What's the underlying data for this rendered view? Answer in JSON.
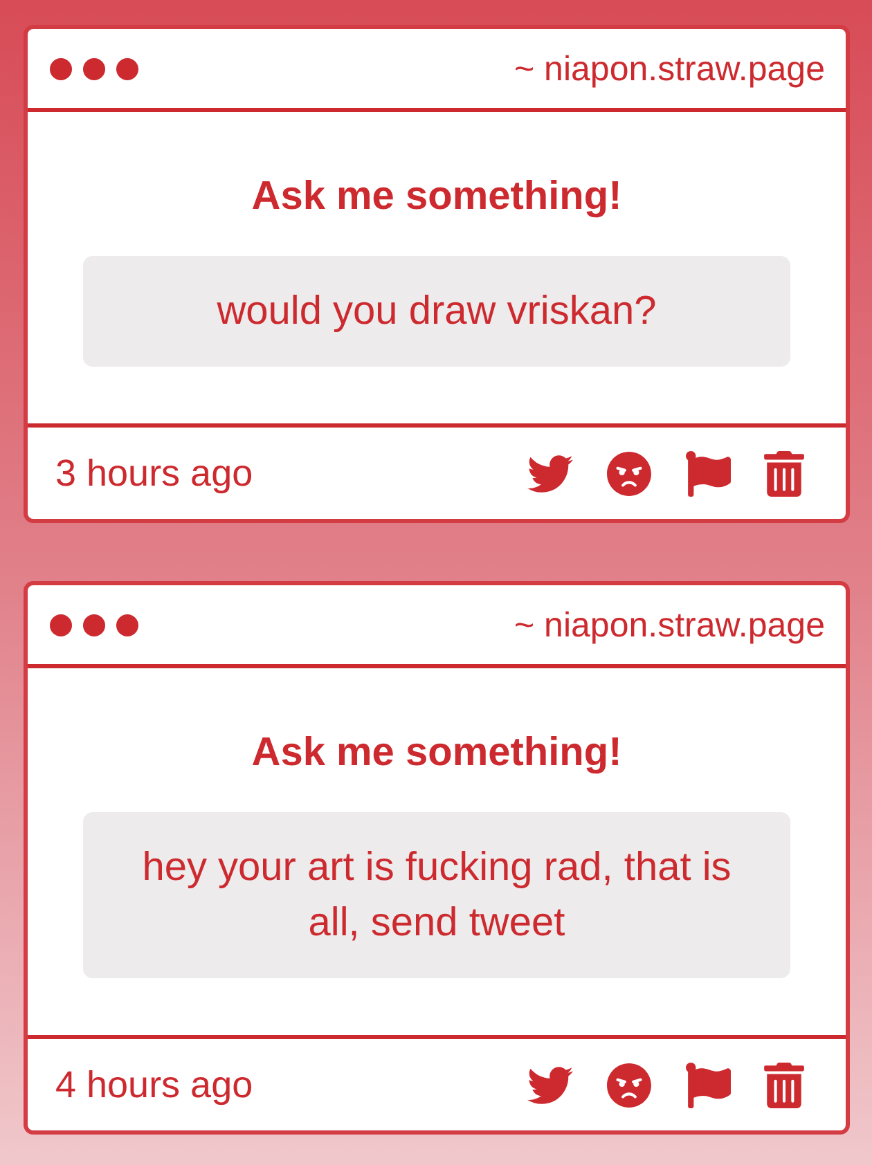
{
  "cards": [
    {
      "header": {
        "url": "~ niapon.straw.page"
      },
      "title": "Ask me something!",
      "question": "would you draw vriskan?",
      "time": "3 hours ago"
    },
    {
      "header": {
        "url": "~ niapon.straw.page"
      },
      "title": "Ask me something!",
      "question": "hey your art is fucking rad, that is all, send tweet",
      "time": "4 hours ago"
    }
  ]
}
